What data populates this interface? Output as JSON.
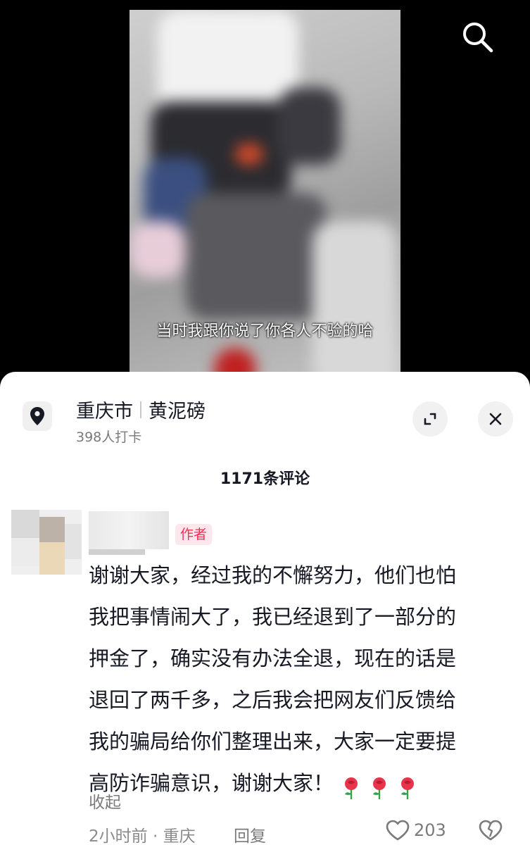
{
  "video": {
    "subtitle": "当时我跟你说了你各人不验的哈",
    "search_icon": "search-icon"
  },
  "location": {
    "icon": "location-pin-icon",
    "city": "重庆市",
    "district": "黄泥磅",
    "checkins": "398人打卡"
  },
  "header_buttons": {
    "expand_icon": "expand-icon",
    "close_icon": "close-icon"
  },
  "comments": {
    "count_title": "1171条评论",
    "items": [
      {
        "author_badge": "作者",
        "text": "谢谢大家，经过我的不懈努力，他们也怕\n我把事情闹大了，我已经退到了一部分的\n押金了，确实没有办法全退，现在的话是\n退回了两千多，之后我会把网友们反馈给\n我的骗局给你们整理出来，大家一定要提\n高防诈骗意识，谢谢大家！",
        "emoji": [
          "rose-emoji",
          "rose-emoji",
          "rose-emoji"
        ],
        "collapse_label": "收起",
        "meta": "2小时前 · 重庆",
        "reply_label": "回复",
        "like_count": "203"
      }
    ]
  },
  "colors": {
    "accent": "#fe2c55",
    "text_primary": "#161823",
    "text_secondary": "#7a7a7a"
  }
}
